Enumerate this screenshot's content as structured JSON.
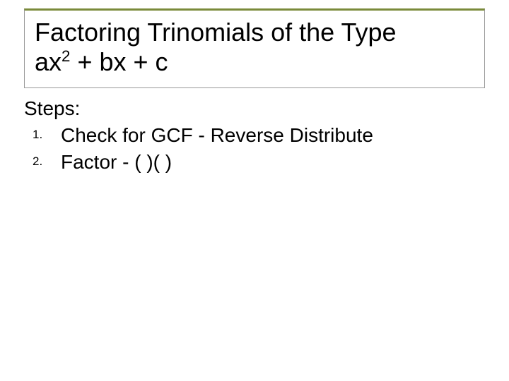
{
  "title": {
    "line1": "Factoring Trinomials of the Type",
    "expr_a": "ax",
    "expr_exp": "2",
    "expr_rest": " + bx + c"
  },
  "body": {
    "heading": "Steps:",
    "items": [
      "Check for GCF - Reverse Distribute",
      "Factor - (   )(   )"
    ]
  }
}
